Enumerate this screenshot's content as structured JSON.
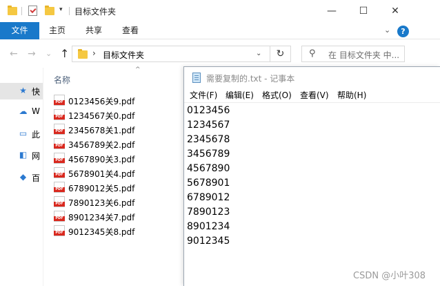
{
  "explorer": {
    "title": "目标文件夹",
    "quick_access_dropdown": "▾",
    "window_controls": {
      "minimize": "—",
      "maximize": "☐",
      "close": "✕"
    },
    "ribbon": {
      "tabs": [
        "文件",
        "主页",
        "共享",
        "查看"
      ],
      "expand_chevron": "⌄",
      "help": "?"
    },
    "nav": {
      "back": "←",
      "forward": "→",
      "recent": "⌄",
      "up": "↑",
      "address_sep": "›",
      "address": "目标文件夹",
      "address_dropdown": "⌄",
      "refresh": "↻",
      "search_placeholder": "在 目标文件夹 中..."
    },
    "nav_pane": [
      {
        "label": "快",
        "icon": "star-icon",
        "glyph": "★",
        "color": "#2b79d0"
      },
      {
        "label": "W",
        "icon": "cloud-icon",
        "glyph": "☁",
        "color": "#2b79d0"
      },
      {
        "label": "此",
        "icon": "computer-icon",
        "glyph": "▭",
        "color": "#2b79d0"
      },
      {
        "label": "网",
        "icon": "network-icon",
        "glyph": "◧",
        "color": "#2b79d0"
      },
      {
        "label": "百",
        "icon": "baidu-icon",
        "glyph": "◆",
        "color": "#2b79d0"
      }
    ],
    "column_header": "名称",
    "sort_indicator": "^",
    "files": [
      "0123456关9.pdf",
      "1234567关0.pdf",
      "2345678关1.pdf",
      "3456789关2.pdf",
      "4567890关3.pdf",
      "5678901关4.pdf",
      "6789012关5.pdf",
      "7890123关6.pdf",
      "8901234关7.pdf",
      "9012345关8.pdf"
    ]
  },
  "notepad": {
    "title": "需要复制的.txt - 记事本",
    "menu": [
      "文件(F)",
      "编辑(E)",
      "格式(O)",
      "查看(V)",
      "帮助(H)"
    ],
    "lines": [
      "0123456",
      "1234567",
      "2345678",
      "3456789",
      "4567890",
      "5678901",
      "6789012",
      "7890123",
      "8901234",
      "9012345"
    ]
  },
  "watermark": "CSDN @小叶308",
  "colors": {
    "accent": "#1979ca",
    "pdf_red": "#d9281e",
    "folder_yellow": "#f5c842"
  }
}
